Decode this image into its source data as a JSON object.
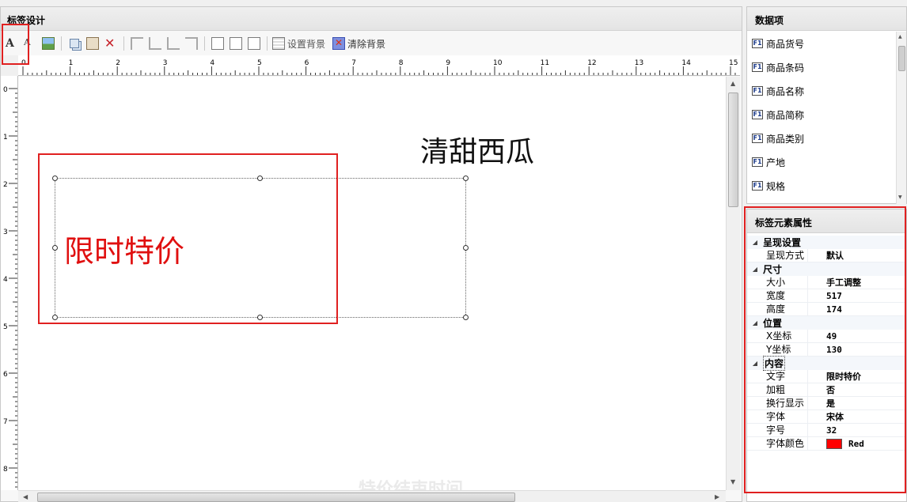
{
  "designer": {
    "title": "标签设计",
    "toolbar": {
      "set_bg_label": "设置背景",
      "clear_bg_label": "清除背景"
    },
    "ruler_top_labels": [
      "0",
      "1",
      "2",
      "3",
      "4",
      "5",
      "6",
      "7",
      "8",
      "9",
      "10",
      "11",
      "12",
      "13",
      "14",
      "15"
    ],
    "ruler_left_labels": [
      "0",
      "1",
      "2",
      "3",
      "4",
      "5",
      "6",
      "7",
      "8"
    ],
    "canvas": {
      "title_text": "清甜西瓜",
      "selected_text": "限时特价",
      "ghost_text": "特价结束时间"
    }
  },
  "data_items": {
    "title": "数据项",
    "items": [
      "商品货号",
      "商品条码",
      "商品名称",
      "商品简称",
      "商品类别",
      "产地",
      "规格"
    ],
    "icon_text": "F1"
  },
  "properties": {
    "title": "标签元素属性",
    "categories": [
      {
        "name": "呈现设置",
        "rows": [
          {
            "k": "呈现方式",
            "v": "默认"
          }
        ]
      },
      {
        "name": "尺寸",
        "rows": [
          {
            "k": "大小",
            "v": "手工调整"
          },
          {
            "k": "宽度",
            "v": "517"
          },
          {
            "k": "高度",
            "v": "174"
          }
        ]
      },
      {
        "name": "位置",
        "rows": [
          {
            "k": "X坐标",
            "v": "49"
          },
          {
            "k": "Y坐标",
            "v": "130"
          }
        ]
      },
      {
        "name": "内容",
        "rows": [
          {
            "k": "文字",
            "v": "限时特价"
          },
          {
            "k": "加粗",
            "v": "否"
          },
          {
            "k": "换行显示",
            "v": "是"
          },
          {
            "k": "字体",
            "v": "宋体"
          },
          {
            "k": "字号",
            "v": "32"
          },
          {
            "k": "字体颜色",
            "v": "Red"
          }
        ]
      }
    ],
    "font_color_hex": "#ff0000"
  },
  "colors": {
    "highlight": "#e02020",
    "selected_text": "#e01010"
  }
}
